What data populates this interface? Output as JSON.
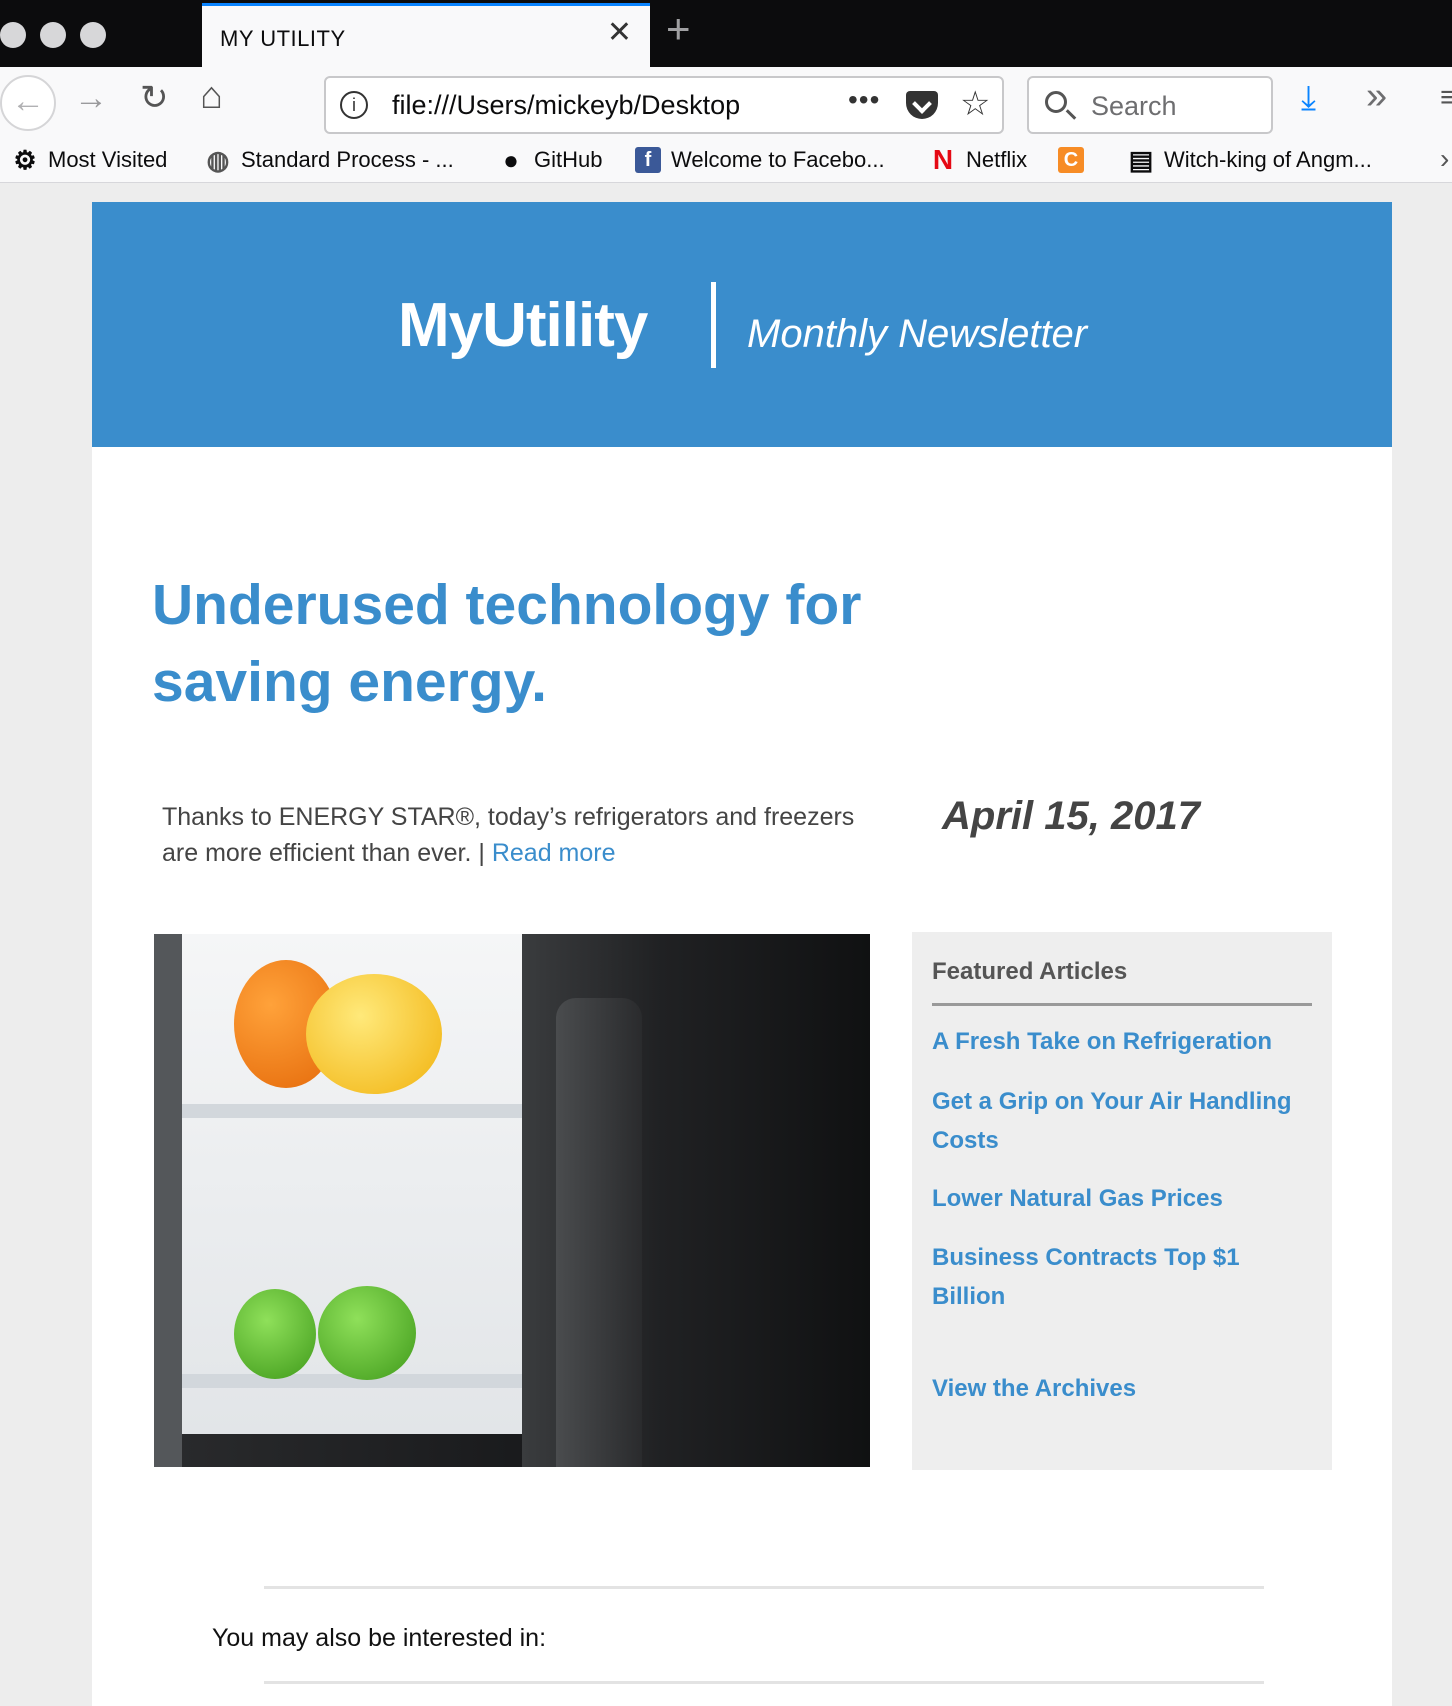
{
  "browser": {
    "tab_title": "MY UTILITY",
    "tab_close": "✕",
    "new_tab": "+",
    "url": "file:///Users/mickeyb/Desktop",
    "url_menu": "•••",
    "search_placeholder": "Search",
    "icons": {
      "back": "←",
      "forward": "→",
      "reload": "↻",
      "home": "⌂",
      "bookmark_star": "☆",
      "download": "⤓",
      "overflow": "»",
      "menu": "≡",
      "bookmarks_overflow": "›"
    },
    "bookmarks": [
      {
        "label": "Most Visited",
        "icon": "gear-icon",
        "glyph": "⚙"
      },
      {
        "label": "Standard Process - ...",
        "icon": "globe-icon",
        "glyph": "◍"
      },
      {
        "label": "GitHub",
        "icon": "github-icon",
        "glyph": "●"
      },
      {
        "label": "Welcome to Facebo...",
        "icon": "facebook-icon",
        "glyph": "f"
      },
      {
        "label": "Netflix",
        "icon": "netflix-icon",
        "glyph": "N"
      },
      {
        "label": "",
        "icon": "crunchyroll-icon",
        "glyph": "C"
      },
      {
        "label": "Witch-king of Angm...",
        "icon": "site-icon",
        "glyph": "▤"
      }
    ]
  },
  "colors": {
    "brand_blue": "#3a8dcc",
    "chrome_dark": "#0c0c0d",
    "accent_tab": "#0a84ff"
  },
  "newsletter": {
    "brand": "MyUtility",
    "subtitle": "Monthly Newsletter",
    "headline": "Underused technology for saving energy.",
    "intro": "Thanks to ENERGY STAR®, today’s refrigerators and freezers are more efficient than ever. |",
    "read_more": "Read more",
    "date": "April 15, 2017",
    "featured": {
      "title": "Featured Articles",
      "links": [
        "A Fresh Take on Refrigeration",
        "Get a Grip on Your Air Handling Costs",
        "Lower Natural Gas Prices",
        "Business Contracts Top $1 Billion"
      ],
      "archives": "View the Archives"
    },
    "also_interested": "You may also be interested in:"
  }
}
